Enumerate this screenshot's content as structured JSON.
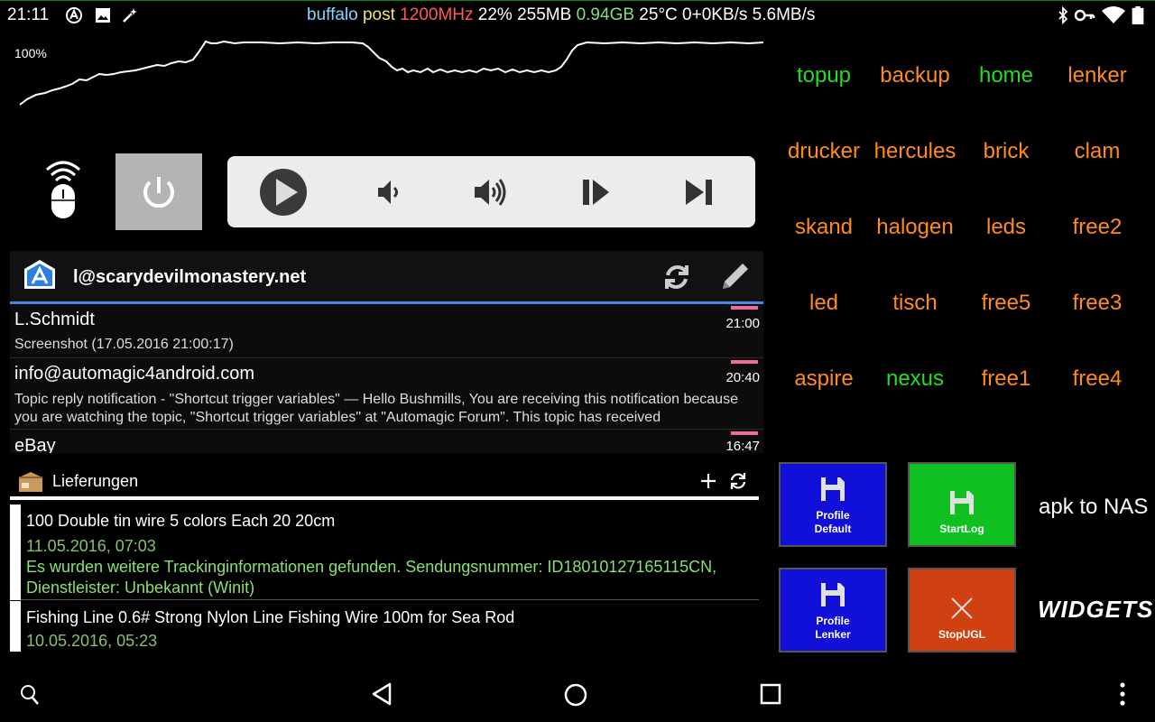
{
  "statusbar": {
    "time": "21:11",
    "stats": [
      {
        "text": "buffalo",
        "color": "#7fd6ff"
      },
      {
        "text": " post",
        "color": "#f4e36a"
      },
      {
        "text": " 1200MHz",
        "color": "#ff5a5a"
      },
      {
        "text": " 22%",
        "color": "#ffffff"
      },
      {
        "text": " 255MB",
        "color": "#ffffff"
      },
      {
        "text": " 0.94GB",
        "color": "#7fe07f"
      },
      {
        "text": " 25°C",
        "color": "#ffffff"
      },
      {
        "text": " 0+0KB/s",
        "color": "#ffffff"
      },
      {
        "text": " 5.6MB/s",
        "color": "#ffffff"
      }
    ],
    "left_icons": [
      "automagic-icon",
      "image-icon",
      "magic-wand-icon"
    ],
    "right_icons": [
      "bluetooth-icon",
      "vpn-key-icon",
      "wifi-icon",
      "battery-icon"
    ]
  },
  "graph": {
    "label": "100%",
    "line_color": "#ffffff"
  },
  "media": {
    "icons": [
      "play-icon",
      "volume-down-icon",
      "volume-up-icon",
      "play-pause-icon",
      "skip-next-icon"
    ]
  },
  "mail": {
    "account": "l@scarydevilmonastery.net",
    "items": [
      {
        "from": "L.Schmidt",
        "time": "21:00",
        "subject": "Screenshot (17.05.2016 21:00:17)"
      },
      {
        "from": "info@automagic4android.com",
        "time": "20:40",
        "subject": "Topic reply notification - \"Shortcut trigger variables\" — Hello Bushmills, You are receiving this notification because you are watching the topic, \"Shortcut trigger variables\" at \"Automagic Forum\". This topic has received"
      },
      {
        "from": "eBay",
        "time": "16:47",
        "subject": ""
      }
    ]
  },
  "deliveries": {
    "title": "Lieferungen",
    "items": [
      {
        "title": "100 Double tin wire 5 colors Each 20 20cm",
        "date": "11.05.2016, 07:03",
        "message": "Es wurden weitere Trackinginformationen gefunden. Sendungsnummer: ID18010127165115CN, Dienstleister: Unbekannt (Winit)"
      },
      {
        "title": "Fishing Line 0.6# Strong Nylon Line Fishing Wire 100m for Sea Rod",
        "date": "10.05.2016, 05:23",
        "message": ""
      }
    ]
  },
  "grid": [
    [
      {
        "label": "topup",
        "color": "#22dd22"
      },
      {
        "label": "backup",
        "color": "#ff8c1a"
      },
      {
        "label": "home",
        "color": "#22dd22"
      },
      {
        "label": "lenker",
        "color": "#ff8c1a"
      }
    ],
    [
      {
        "label": "drucker",
        "color": "#ff8c1a"
      },
      {
        "label": "hercules",
        "color": "#ff8c1a"
      },
      {
        "label": "brick",
        "color": "#ff8c1a"
      },
      {
        "label": "clam",
        "color": "#ff8c1a"
      }
    ],
    [
      {
        "label": "skand",
        "color": "#ff8c1a"
      },
      {
        "label": "halogen",
        "color": "#ff8c1a"
      },
      {
        "label": "leds",
        "color": "#ff8c1a"
      },
      {
        "label": "free2",
        "color": "#ff8c1a"
      }
    ],
    [
      {
        "label": "led",
        "color": "#ff8c1a"
      },
      {
        "label": "tisch",
        "color": "#ff8c1a"
      },
      {
        "label": "free5",
        "color": "#ff8c1a"
      },
      {
        "label": "free3",
        "color": "#ff8c1a"
      }
    ],
    [
      {
        "label": "aspire",
        "color": "#ff8c1a"
      },
      {
        "label": "nexus",
        "color": "#22dd22"
      },
      {
        "label": "free1",
        "color": "#ff8c1a"
      },
      {
        "label": "free4",
        "color": "#ff8c1a"
      }
    ]
  ],
  "tiles": [
    {
      "label": "Profile\nDefault",
      "icon": "save-icon",
      "color": "#1010d8"
    },
    {
      "label": "StartLog",
      "icon": "save-icon",
      "color": "#10c020"
    },
    {
      "label": "Profile\nLenker",
      "icon": "save-icon",
      "color": "#1010d8"
    },
    {
      "label": "StopUGL",
      "icon": "close-icon",
      "color": "#d04010"
    }
  ],
  "apk_label": "apk to NAS",
  "widgets_label": "WIDGETS",
  "navbar": {
    "icons": [
      "search-icon",
      "back-icon",
      "home-icon",
      "recents-icon",
      "more-vert-icon"
    ]
  }
}
